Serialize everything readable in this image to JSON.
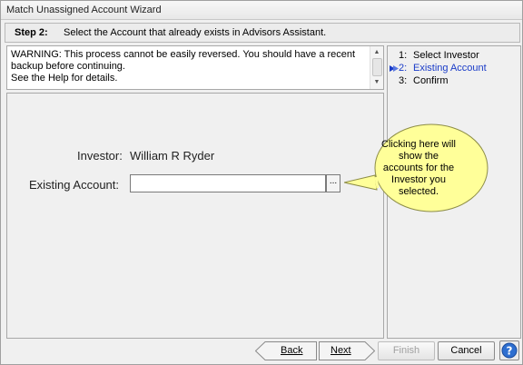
{
  "window": {
    "title": "Match Unassigned Account Wizard"
  },
  "step": {
    "number": "Step 2:",
    "instruction": "Select the Account that already exists in Advisors Assistant."
  },
  "warning": {
    "line1": "WARNING:  This process cannot be easily reversed. You should have a recent",
    "line2": "backup before continuing.",
    "line3": "See the Help for details."
  },
  "form": {
    "investor_label": "Investor:",
    "investor_value": "William R Ryder",
    "account_label": "Existing Account:",
    "account_value": "",
    "browse_label": "..."
  },
  "callout": {
    "line1": "Clicking here will",
    "line2": "show the",
    "line3": "accounts for the",
    "line4": "Investor you",
    "line5": "selected."
  },
  "steps": [
    {
      "num": "1:",
      "label": "Select Investor"
    },
    {
      "num": "2:",
      "label": "Existing Account"
    },
    {
      "num": "3:",
      "label": "Confirm"
    }
  ],
  "buttons": {
    "back": "Back",
    "next": "Next",
    "finish": "Finish",
    "cancel": "Cancel"
  },
  "colors": {
    "current_step": "#1a3cc8",
    "callout_fill": "#ffff99"
  },
  "icons": {
    "current_step": "arrow-icon",
    "help": "help-icon"
  }
}
